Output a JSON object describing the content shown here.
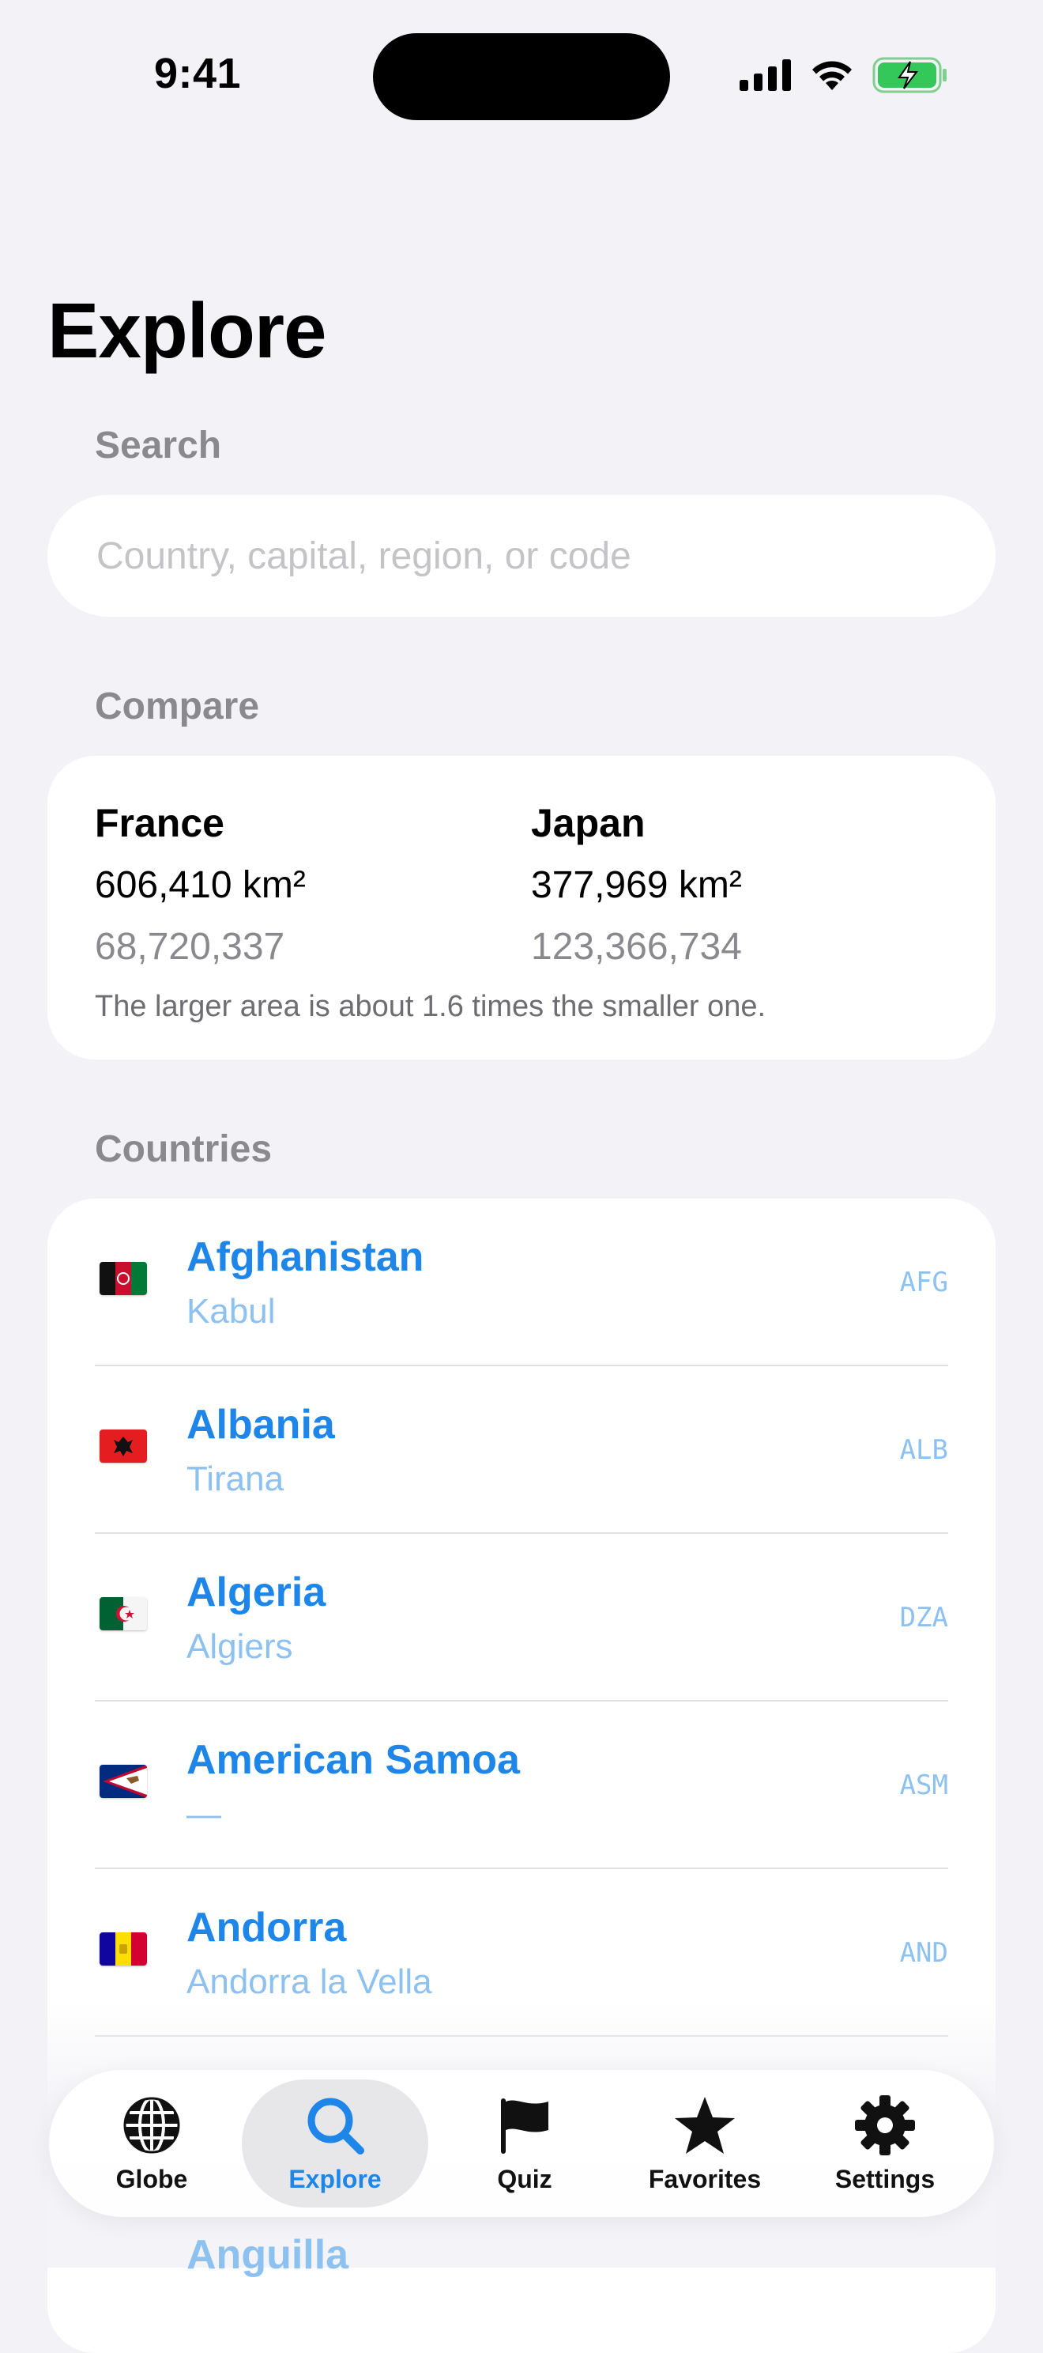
{
  "status_bar": {
    "time": "9:41"
  },
  "page": {
    "title": "Explore"
  },
  "search": {
    "label": "Search",
    "placeholder": "Country, capital, region, or code",
    "value": ""
  },
  "compare": {
    "label": "Compare",
    "left": {
      "name": "France",
      "area": "606,410 km²",
      "population": "68,720,337"
    },
    "right": {
      "name": "Japan",
      "area": "377,969 km²",
      "population": "123,366,734"
    },
    "note": "The larger area is about 1.6 times the smaller one."
  },
  "countries": {
    "label": "Countries",
    "items": [
      {
        "name": "Afghanistan",
        "capital": "Kabul",
        "code": "AFG",
        "flag": "afghanistan-flag-icon"
      },
      {
        "name": "Albania",
        "capital": "Tirana",
        "code": "ALB",
        "flag": "albania-flag-icon"
      },
      {
        "name": "Algeria",
        "capital": "Algiers",
        "code": "DZA",
        "flag": "algeria-flag-icon"
      },
      {
        "name": "American Samoa",
        "capital": "—",
        "code": "ASM",
        "flag": "american-samoa-flag-icon"
      },
      {
        "name": "Andorra",
        "capital": "Andorra la Vella",
        "code": "AND",
        "flag": "andorra-flag-icon"
      }
    ],
    "peek_name": "Anguilla"
  },
  "tab_bar": {
    "tabs": [
      {
        "label": "Globe",
        "icon": "globe-icon"
      },
      {
        "label": "Explore",
        "icon": "magnifying-glass-icon"
      },
      {
        "label": "Quiz",
        "icon": "flag-icon"
      },
      {
        "label": "Favorites",
        "icon": "star-icon"
      },
      {
        "label": "Settings",
        "icon": "gear-icon"
      }
    ],
    "active": "Explore"
  },
  "colors": {
    "accent": "#1d86e8",
    "accent_light": "#8cc1f0",
    "background": "#f2f2f7",
    "secondary_text": "#8a8a8e",
    "battery": "#34c759"
  }
}
